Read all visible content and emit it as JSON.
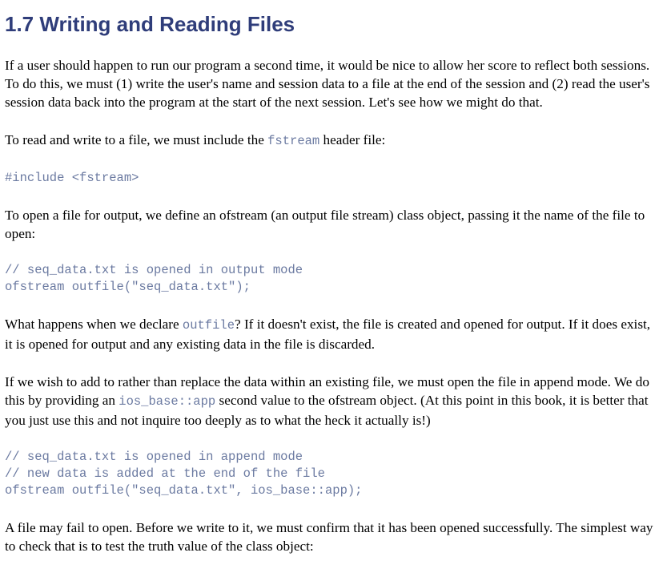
{
  "title": "1.7 Writing and Reading Files",
  "para1": "If a user should happen to run our program a second time, it would be nice to allow her score to reflect both sessions. To do this, we must (1) write the user's name and session data to a file at the end of the session and (2) read the user's session data back into the program at the start of the next session. Let's see how we might do that.",
  "para2": {
    "before": "To read and write to a file, we must include the ",
    "code": "fstream",
    "after": " header file:"
  },
  "code1": [
    "#include <fstream>"
  ],
  "para3": "To open a file for output, we define an ofstream (an output file stream) class object, passing it the name of the file to open:",
  "code2": [
    "// seq_data.txt is opened in output mode",
    "ofstream outfile(\"seq_data.txt\");"
  ],
  "para4": {
    "before": "What happens when we declare ",
    "code": "outfile",
    "after": "? If it doesn't exist, the file is created and opened for output. If it does exist, it is opened for output and any existing data in the file is discarded."
  },
  "para5": {
    "before": "If we wish to add to rather than replace the data within an existing file, we must open the file in append mode. We do this by providing an ",
    "code": "ios_base::app",
    "after": " second value to the ofstream object. (At this point in this book, it is better that you just use this and not inquire too deeply as to what the heck it actually is!)"
  },
  "code3": [
    "// seq_data.txt is opened in append mode",
    "// new data is added at the end of the file",
    "ofstream outfile(\"seq_data.txt\", ios_base::app);"
  ],
  "para6": "A file may fail to open. Before we write to it, we must confirm that it has been opened successfully. The simplest way to check that is to test the truth value of the class object:",
  "colors": {
    "heading": "#2f3d7a",
    "code": "#6b7aa1",
    "text": "#000000"
  }
}
